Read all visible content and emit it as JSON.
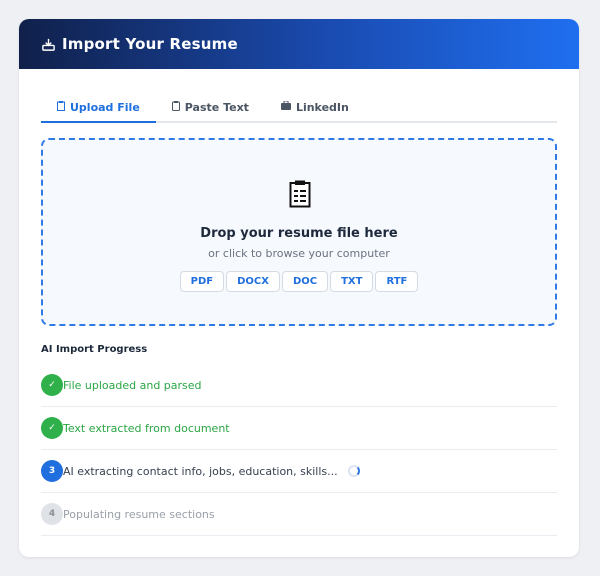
{
  "header": {
    "title": "Import Your Resume",
    "icon": "inbox-tray-icon"
  },
  "tabs": [
    {
      "label": "Upload File",
      "icon": "clipboard-icon",
      "active": true
    },
    {
      "label": "Paste Text",
      "icon": "clipboard-paste-icon",
      "active": false
    },
    {
      "label": "LinkedIn",
      "icon": "briefcase-icon",
      "active": false
    }
  ],
  "dropzone": {
    "icon": "document-icon",
    "title": "Drop your resume file here",
    "subtitle": "or click to browse your computer",
    "formats": [
      "PDF",
      "DOCX",
      "DOC",
      "TXT",
      "RTF"
    ]
  },
  "progress": {
    "title": "AI Import Progress",
    "steps": [
      {
        "marker": "✓",
        "text": "File uploaded and parsed",
        "status": "done"
      },
      {
        "marker": "✓",
        "text": "Text extracted from document",
        "status": "done"
      },
      {
        "marker": "3",
        "text": "AI extracting contact info, jobs, education, skills...",
        "status": "active"
      },
      {
        "marker": "4",
        "text": "Populating resume sections",
        "status": "pending"
      }
    ]
  },
  "colors": {
    "accent": "#1f6fdf",
    "success": "#2fb04a",
    "pending": "#dfe2e6"
  }
}
